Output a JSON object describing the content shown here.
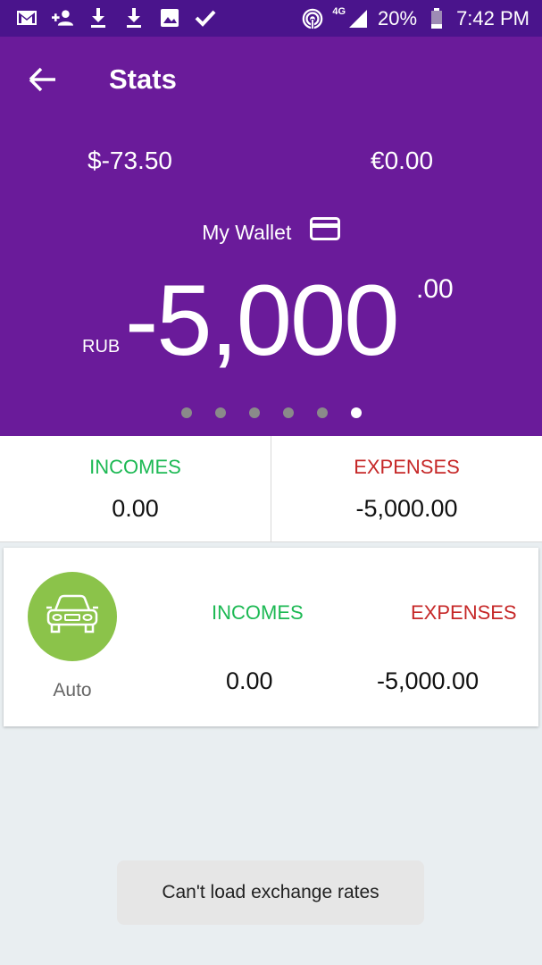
{
  "status_bar": {
    "network": "4G",
    "battery": "20%",
    "time": "7:42 PM"
  },
  "header": {
    "title": "Stats",
    "accounts": [
      {
        "amount": "$-73.50"
      },
      {
        "amount": "€0.00"
      }
    ],
    "wallet_name": "My Wallet",
    "currency": "RUB",
    "balance_main": "-5,000",
    "balance_cents": ".00",
    "page_count": 6,
    "active_page": 6
  },
  "summary": {
    "incomes_label": "INCOMES",
    "incomes_value": "0.00",
    "expenses_label": "EXPENSES",
    "expenses_value": "-5,000.00"
  },
  "category": {
    "name": "Auto",
    "icon": "car-icon",
    "incomes_label": "INCOMES",
    "incomes_value": "0.00",
    "expenses_label": "EXPENSES",
    "expenses_value": "-5,000.00"
  },
  "toast": {
    "message": "Can't load exchange rates"
  },
  "colors": {
    "header": "#6a1b9a",
    "status_bar": "#4a148c",
    "income": "#1db954",
    "expense": "#c62828",
    "category": "#8bc34a"
  }
}
